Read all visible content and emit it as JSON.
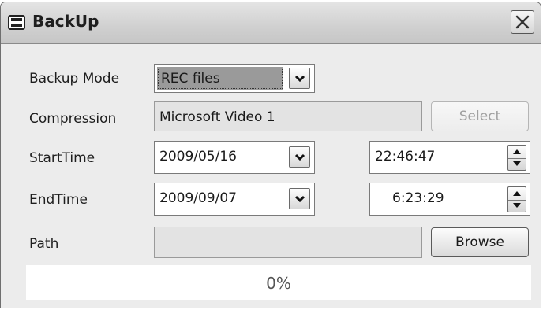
{
  "window": {
    "title": "BackUp",
    "icon": "backup-drive-icon",
    "close_icon": "close-icon"
  },
  "form": {
    "backup_mode": {
      "label": "Backup Mode",
      "value": "REC files"
    },
    "compression": {
      "label": "Compression",
      "value": "Microsoft Video 1",
      "select_label": "Select"
    },
    "start_time": {
      "label": "StartTime",
      "date": "2009/05/16",
      "time": "22:46:47"
    },
    "end_time": {
      "label": "EndTime",
      "date": "2009/09/07",
      "time": "6:23:29"
    },
    "path": {
      "label": "Path",
      "value": "",
      "browse_label": "Browse"
    }
  },
  "progress": {
    "value": 0,
    "text": "0%"
  }
}
